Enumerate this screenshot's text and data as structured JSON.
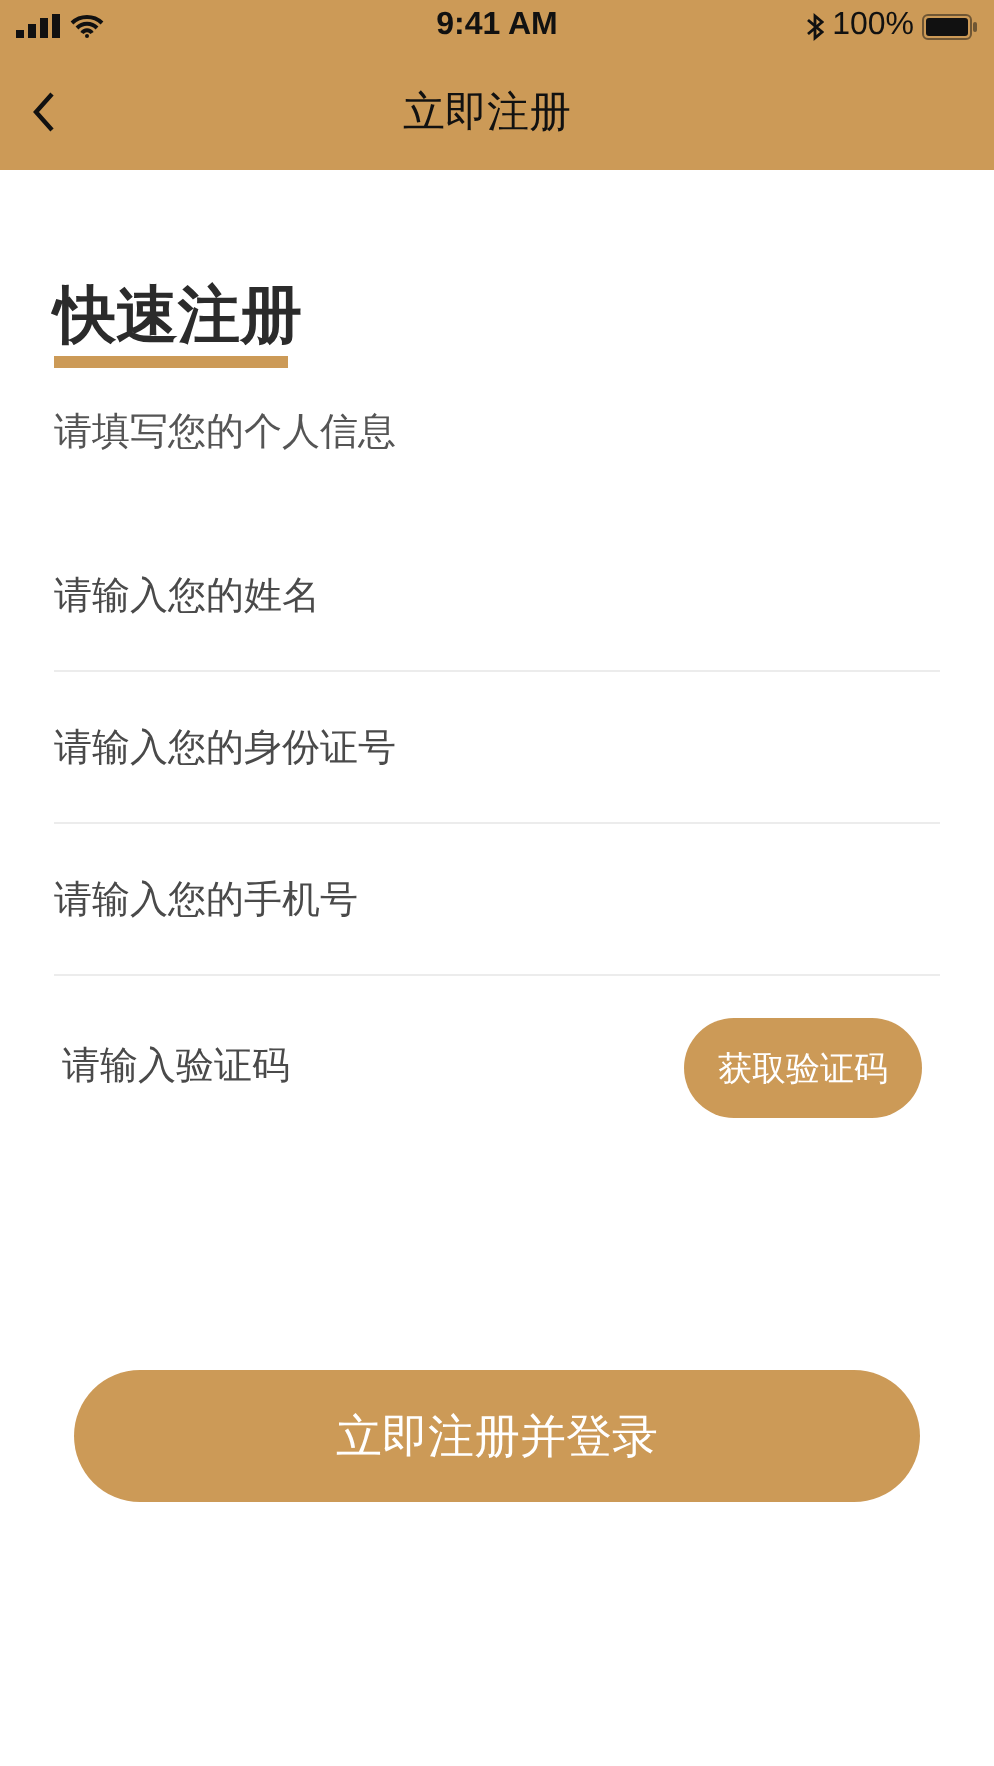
{
  "status_bar": {
    "time": "9:41 AM",
    "battery": "100%"
  },
  "nav_bar": {
    "title": "立即注册"
  },
  "heading": "快速注册",
  "subtitle": "请填写您的个人信息",
  "fields": [
    {
      "kind": "text",
      "placeholder": "请输入您的姓名"
    },
    {
      "kind": "text",
      "placeholder": "请输入您的身份证号"
    },
    {
      "kind": "text",
      "placeholder": "请输入您的手机号"
    },
    {
      "kind": "code",
      "placeholder": "请输入验证码",
      "action": "获取验证码"
    }
  ],
  "submit_button": "立即注册并登录"
}
